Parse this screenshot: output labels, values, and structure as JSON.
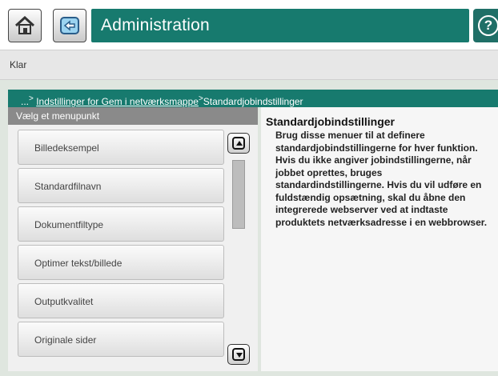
{
  "header": {
    "title": "Administration",
    "help_label": "?",
    "accent_color": "#177a6e",
    "icons": {
      "home": "home-icon",
      "back": "back-arrow-icon",
      "help": "help-icon"
    }
  },
  "status": {
    "text": "Klar"
  },
  "breadcrumb": {
    "prefix": "...",
    "separator": ">",
    "parent": "Indstillinger for Gem i netværksmappe",
    "current": "Standardjobindstillinger"
  },
  "menu": {
    "header": "Vælg et menupunkt",
    "items": [
      {
        "label": "Billedeksempel"
      },
      {
        "label": "Standardfilnavn"
      },
      {
        "label": "Dokumentfiltype"
      },
      {
        "label": "Optimer tekst/billede"
      },
      {
        "label": "Outputkvalitet"
      },
      {
        "label": "Originale sider"
      }
    ]
  },
  "info": {
    "title": "Standardjobindstillinger",
    "body": "Brug disse menuer til at definere standardjobindstillingerne for hver funktion. Hvis du ikke angiver jobindstillingerne, når jobbet oprettes, bruges standardindstillingerne. Hvis du vil udføre en fuldstændig opsætning, skal du åbne den integrerede webserver ved at indtaste produktets netværksadresse i en webbrowser."
  }
}
